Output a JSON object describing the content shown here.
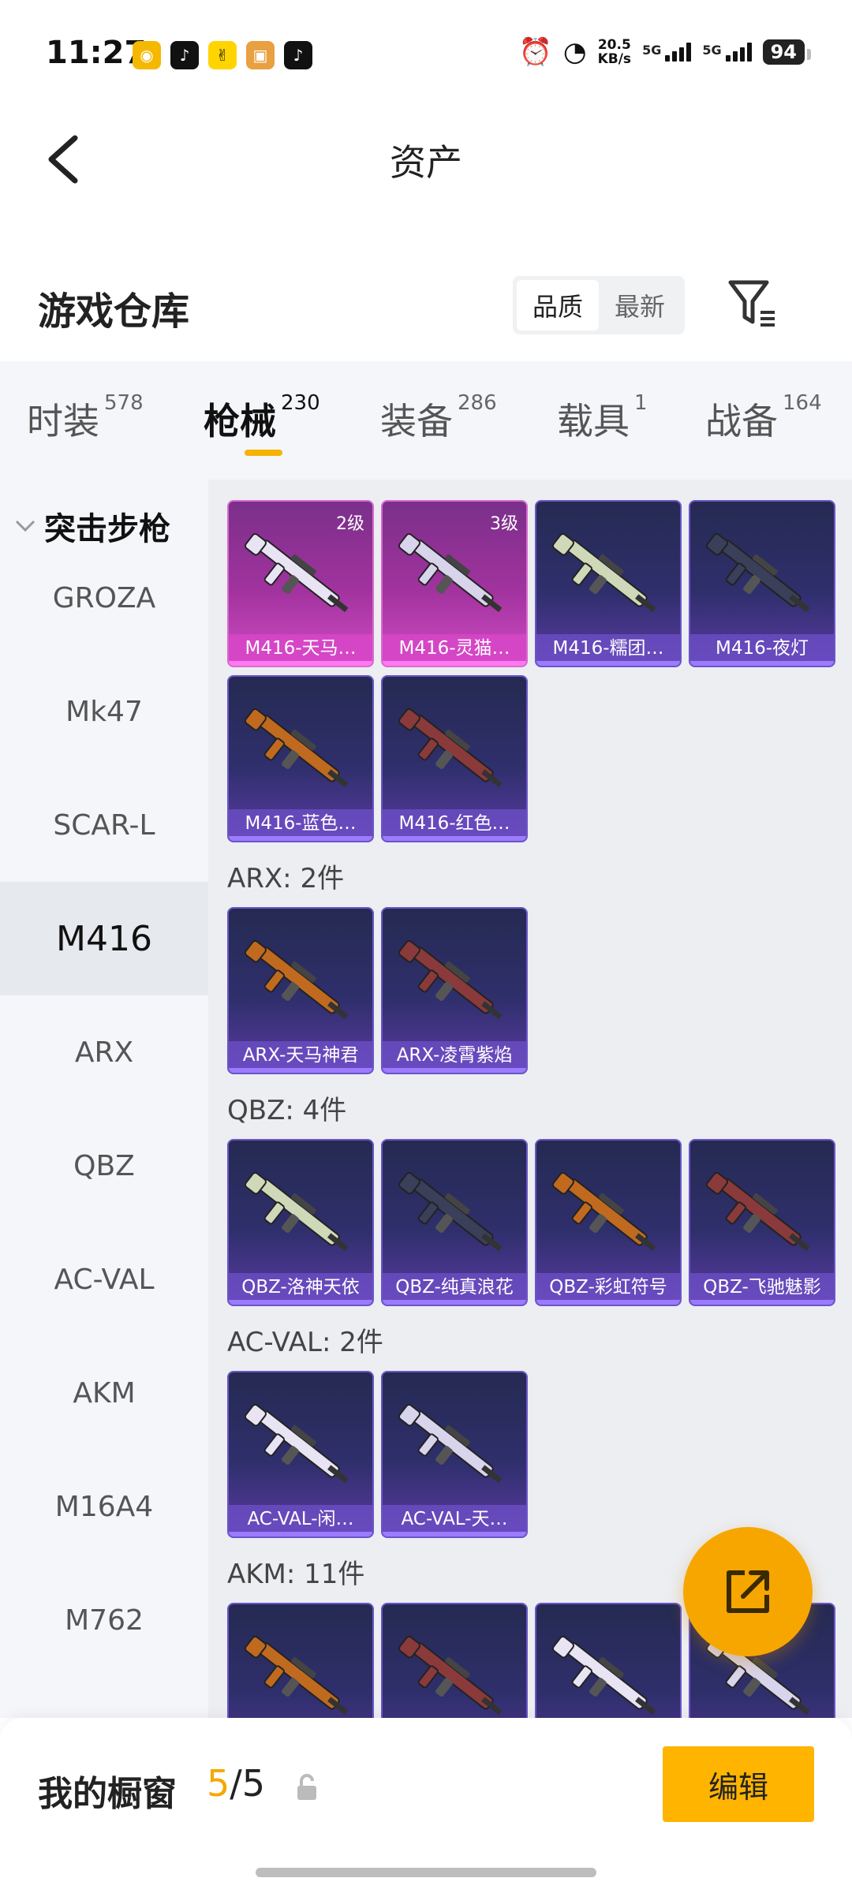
{
  "status_bar": {
    "time": "11:27",
    "speed_value": "20.5",
    "speed_unit": "KB/s",
    "net1": "5G",
    "net2": "5G",
    "battery": "94"
  },
  "header": {
    "title": "资产"
  },
  "warehouse": {
    "title": "游戏仓库",
    "sort_options": [
      "品质",
      "最新"
    ],
    "active_sort": "品质"
  },
  "categories": [
    {
      "label": "时装",
      "count": "578"
    },
    {
      "label": "枪械",
      "count": "230"
    },
    {
      "label": "装备",
      "count": "286"
    },
    {
      "label": "载具",
      "count": "1"
    },
    {
      "label": "战备",
      "count": "164"
    }
  ],
  "active_category": "枪械",
  "sidenav": {
    "group": "突击步枪",
    "items": [
      "GROZA",
      "Mk47",
      "SCAR-L",
      "M416",
      "ARX",
      "QBZ",
      "AC-VAL",
      "AKM",
      "M16A4",
      "M762"
    ],
    "active": "M416"
  },
  "sections": [
    {
      "title": "",
      "items": [
        {
          "name": "M416-天马…",
          "level": "2级",
          "rarity": "pink"
        },
        {
          "name": "M416-灵猫…",
          "level": "3级",
          "rarity": "pink"
        },
        {
          "name": "M416-糯团…",
          "level": "",
          "rarity": "purple"
        },
        {
          "name": "M416-夜灯",
          "level": "",
          "rarity": "purple"
        },
        {
          "name": "M416-蓝色…",
          "level": "",
          "rarity": "purple"
        },
        {
          "name": "M416-红色…",
          "level": "",
          "rarity": "purple"
        }
      ]
    },
    {
      "title": "ARX: 2件",
      "items": [
        {
          "name": "ARX-天马神君",
          "level": "",
          "rarity": "purple"
        },
        {
          "name": "ARX-凌霄紫焰",
          "level": "",
          "rarity": "purple"
        }
      ]
    },
    {
      "title": "QBZ: 4件",
      "items": [
        {
          "name": "QBZ-洛神天依",
          "level": "",
          "rarity": "purple"
        },
        {
          "name": "QBZ-纯真浪花",
          "level": "",
          "rarity": "purple"
        },
        {
          "name": "QBZ-彩虹符号",
          "level": "",
          "rarity": "purple"
        },
        {
          "name": "QBZ-飞驰魅影",
          "level": "",
          "rarity": "purple"
        }
      ]
    },
    {
      "title": "AC-VAL: 2件",
      "items": [
        {
          "name": "AC-VAL-闲…",
          "level": "",
          "rarity": "purple"
        },
        {
          "name": "AC-VAL-天…",
          "level": "",
          "rarity": "purple"
        }
      ]
    },
    {
      "title": "AKM: 11件",
      "items": [
        {
          "name": "",
          "level": "",
          "rarity": "purple"
        },
        {
          "name": "",
          "level": "",
          "rarity": "purple"
        },
        {
          "name": "",
          "level": "",
          "rarity": "purple"
        },
        {
          "name": "",
          "level": "",
          "rarity": "purple"
        }
      ]
    }
  ],
  "showcase": {
    "label": "我的橱窗",
    "current": "5",
    "separator": "/",
    "total": "5",
    "edit_label": "编辑"
  },
  "colors": {
    "accent": "#ffb400",
    "tab_underline": "#f5b300",
    "fab": "#f7a600",
    "card_purple": "#2f2f6c",
    "card_pink": "#a2339e"
  },
  "icons": {
    "back": "back-arrow-icon",
    "filter": "filter-icon",
    "fab": "share-external-icon",
    "lock": "lock-icon",
    "chevron": "chevron-down-icon"
  }
}
